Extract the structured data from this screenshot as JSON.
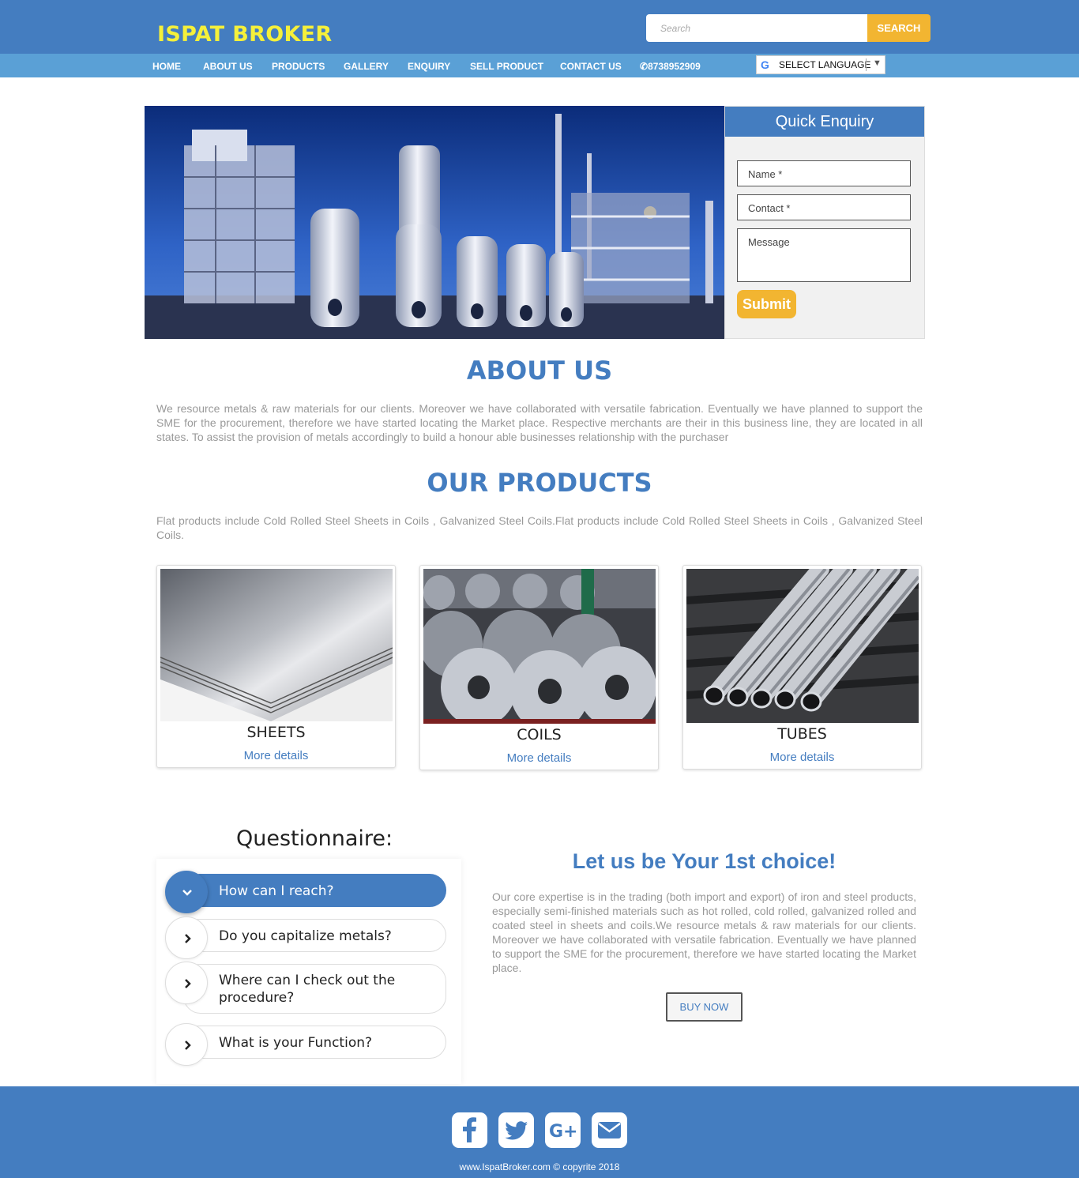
{
  "brand": {
    "name": "ISPAT BROKER"
  },
  "search": {
    "placeholder": "Search",
    "button_label": "SEARCH"
  },
  "nav": {
    "items": [
      {
        "label": "HOME"
      },
      {
        "label": "ABOUT US"
      },
      {
        "label": "PRODUCTS"
      },
      {
        "label": "GALLERY"
      },
      {
        "label": "ENQUIRY"
      },
      {
        "label": "SELL PRODUCT"
      },
      {
        "label": "CONTACT US"
      },
      {
        "label": "8738952909"
      }
    ],
    "language": "SELECT LANGUAGE"
  },
  "enquiry": {
    "title": "Quick Enquiry",
    "name_placeholder": "Name *",
    "contact_placeholder": "Contact *",
    "message_placeholder": "Message",
    "submit_label": "Submit"
  },
  "about": {
    "title": "ABOUT US",
    "text": "We resource metals & raw materials for our clients. Moreover we have collaborated with versatile fabrication. Eventually we have planned to support the SME for the procurement, therefore we have started locating the Market place. Respective merchants are their in this business line, they are located in all states. To assist the provision of metals accordingly to build a honour able businesses relationship with the purchaser"
  },
  "products": {
    "title": "OUR PRODUCTS",
    "text": "Flat products include Cold Rolled Steel Sheets in Coils , Galvanized Steel Coils.Flat products include Cold Rolled Steel Sheets in Coils , Galvanized Steel Coils.",
    "items": [
      {
        "name": "SHEETS",
        "link": "More details"
      },
      {
        "name": "COILS",
        "link": "More details"
      },
      {
        "name": "TUBES",
        "link": "More details"
      }
    ]
  },
  "questionnaire": {
    "title": "Questionnaire:",
    "items": [
      {
        "question": "How can I reach?"
      },
      {
        "question": "Do you capitalize metals?"
      },
      {
        "question": "Where can I check out the procedure?"
      },
      {
        "question": "What is your Function?"
      }
    ]
  },
  "choice": {
    "title": "Let us be Your 1st choice!",
    "text": "Our core expertise is in the trading (both import and export) of iron and steel products, especially semi-finished materials such as hot rolled, cold rolled, galvanized rolled and coated steel in sheets and coils.We resource metals & raw materials for our clients. Moreover we have collaborated with versatile fabrication. Eventually we have planned to support the SME for the procurement, therefore we have started locating the Market place.",
    "button_label": "BUY NOW"
  },
  "footer": {
    "social_icons": [
      "facebook-icon",
      "twitter-icon",
      "google-plus-icon",
      "email-icon"
    ],
    "copyright": "www.IspatBroker.com © copyrite 2018"
  },
  "colors": {
    "primary": "#447dc0",
    "nav": "#5aa0d6",
    "accent": "#f2b531",
    "logo": "#f5f03a"
  }
}
